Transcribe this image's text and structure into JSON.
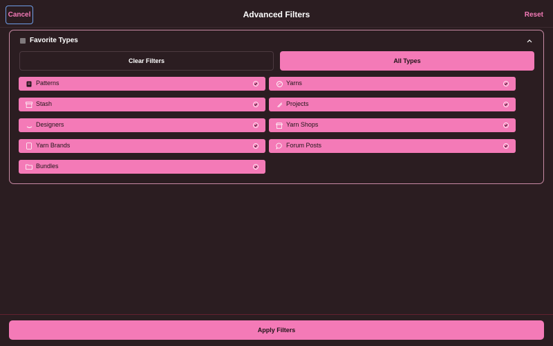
{
  "header": {
    "cancel_label": "Cancel",
    "title": "Advanced Filters",
    "reset_label": "Reset"
  },
  "panel": {
    "title": "Favorite Types",
    "icon": "square-icon",
    "clear_label": "Clear Filters",
    "all_label": "All Types",
    "types": [
      {
        "label": "Patterns",
        "icon": "pattern-icon",
        "checked": true
      },
      {
        "label": "Yarns",
        "icon": "yarn-icon",
        "checked": true
      },
      {
        "label": "Stash",
        "icon": "stash-icon",
        "checked": true
      },
      {
        "label": "Projects",
        "icon": "project-icon",
        "checked": true
      },
      {
        "label": "Designers",
        "icon": "designer-icon",
        "checked": true
      },
      {
        "label": "Yarn Shops",
        "icon": "shop-icon",
        "checked": true
      },
      {
        "label": "Yarn Brands",
        "icon": "brand-icon",
        "checked": true
      },
      {
        "label": "Forum Posts",
        "icon": "forum-icon",
        "checked": true
      },
      {
        "label": "Bundles",
        "icon": "folder-icon",
        "checked": true
      }
    ]
  },
  "footer": {
    "apply_label": "Apply Filters"
  },
  "colors": {
    "background": "#2b1d21",
    "accent": "#f47ab7",
    "focus": "#6f9ee8"
  }
}
